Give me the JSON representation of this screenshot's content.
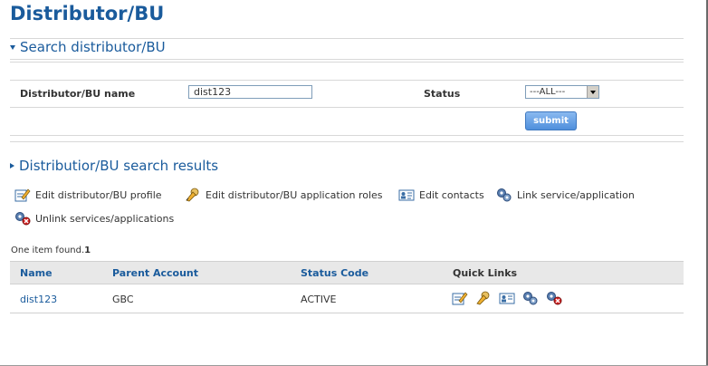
{
  "page_title": "Distributor/BU",
  "search_section": {
    "title": "Search distributor/BU",
    "name_label": "Distributor/BU name",
    "name_value": "dist123",
    "status_label": "Status",
    "status_value": "---ALL---",
    "submit_label": "submit"
  },
  "results_section": {
    "title": "Distributior/BU search results",
    "actions": [
      {
        "label": "Edit distributor/BU profile",
        "icon": "edit-profile-icon"
      },
      {
        "label": "Edit distributor/BU application roles",
        "icon": "edit-roles-icon"
      },
      {
        "label": "Edit contacts",
        "icon": "contacts-card-icon"
      },
      {
        "label": "Link service/application",
        "icon": "link-service-gears-icon"
      },
      {
        "label": "Unlink services/applications",
        "icon": "unlink-service-gears-icon"
      }
    ],
    "count_text": "One item found.",
    "count_value": "1",
    "table": {
      "headers": [
        "Name",
        "Parent Account",
        "Status Code",
        "Quick Links"
      ],
      "rows": [
        {
          "name": "dist123",
          "parent_account": "GBC",
          "status_code": "ACTIVE"
        }
      ]
    }
  },
  "colors": {
    "accent": "#1a5b9c",
    "header_bg": "#e8e8e8",
    "button": "#4f8fdc"
  }
}
